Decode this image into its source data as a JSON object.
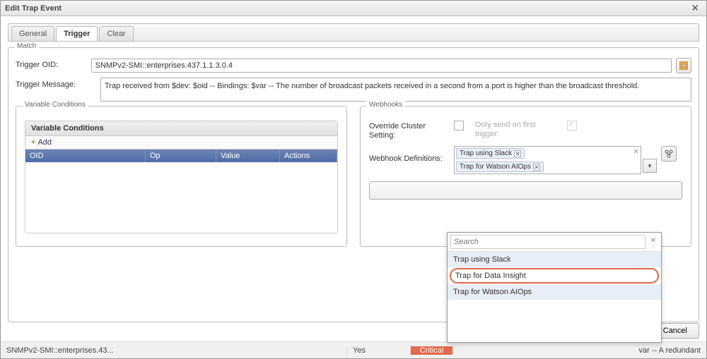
{
  "window": {
    "title": "Edit Trap Event"
  },
  "tabs": {
    "general": "General",
    "trigger": "Trigger",
    "clear": "Clear"
  },
  "match": {
    "legend": "Match",
    "trigger_oid_label": "Trigger OID:",
    "trigger_oid_value": "SNMPv2-SMI::enterprises.437.1.1.3.0.4",
    "trigger_msg_label": "Trigger Message:",
    "trigger_msg_value": "Trap received from $dev: $oid -- Bindings: $var -- The number of broadcast packets received in a second from a port is higher than the broadcast threshold."
  },
  "variable_conditions": {
    "legend": "Variable Conditions",
    "panel_title": "Variable Conditions",
    "add_label": "Add",
    "headers": {
      "oid": "OID",
      "op": "Op",
      "value": "Value",
      "actions": "Actions"
    }
  },
  "webhooks": {
    "legend": "Webhooks",
    "override_label": "Override Cluster Setting:",
    "only_send_label": "Only send on first trigger:",
    "definitions_label": "Webhook Definitions:",
    "chips": [
      "Trap using Slack",
      "Trap for Watson AIOps"
    ]
  },
  "dropdown": {
    "search_placeholder": "Search",
    "items": [
      "Trap using Slack",
      "Trap for Data Insight",
      "Trap for Watson AIOps"
    ]
  },
  "footer": {
    "cancel": "Cancel"
  },
  "bgrow": {
    "oid": "SNMPv2-SMI::enterprises.43...",
    "yes": "Yes",
    "critical": "Critical",
    "msg": "var -- A redundant"
  }
}
